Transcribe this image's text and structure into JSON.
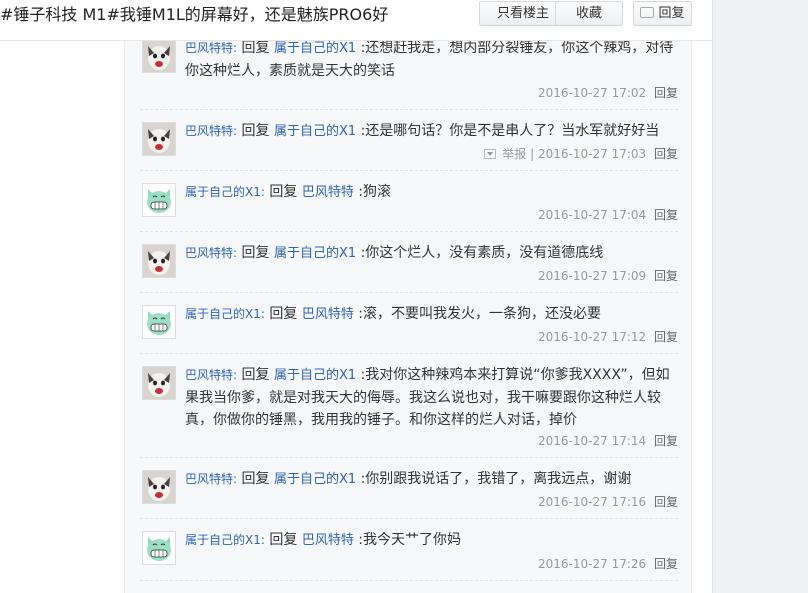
{
  "thread": {
    "title": "#锤子科技 M1#我锤M1L的屏幕好，还是魅族PRO6好",
    "buttons": {
      "only_op": "只看楼主",
      "favorite": "收藏",
      "reply": "回复"
    }
  },
  "comments": [
    {
      "user": "巴风特特:",
      "avatar": "avatar-cat-photo",
      "reply_word": "回复",
      "target": "属于自己的X1",
      "text": ":还想赶我走，想内部分裂锤友，你这个辣鸡，对待你这种烂人，素质就是天大的笑话",
      "time": "2016-10-27 17:02",
      "reply": "回复"
    },
    {
      "user": "巴风特特:",
      "avatar": "avatar-cat-photo",
      "reply_word": "回复",
      "target": "属于自己的X1",
      "text": ":还是哪句话？你是不是串人了？当水军就好好当",
      "report": "举报",
      "separator": "|",
      "time": "2016-10-27 17:03",
      "reply": "回复"
    },
    {
      "user": "属于自己的X1:",
      "avatar": "avatar-green-cat",
      "reply_word": "回复",
      "target": "巴风特特",
      "text": ":狗滚",
      "time": "2016-10-27 17:04",
      "reply": "回复"
    },
    {
      "user": "巴风特特:",
      "avatar": "avatar-cat-photo",
      "reply_word": "回复",
      "target": "属于自己的X1",
      "text": ":你这个烂人，没有素质，没有道德底线",
      "time": "2016-10-27 17:09",
      "reply": "回复"
    },
    {
      "user": "属于自己的X1:",
      "avatar": "avatar-green-cat",
      "reply_word": "回复",
      "target": "巴风特特",
      "text": ":滚，不要叫我发火，一条狗，还没必要",
      "time": "2016-10-27 17:12",
      "reply": "回复"
    },
    {
      "user": "巴风特特:",
      "avatar": "avatar-cat-photo",
      "reply_word": "回复",
      "target": "属于自己的X1",
      "text": ":我对你这种辣鸡本来打算说“你爹我XXXX”，但如果我当你爹，就是对我天大的侮辱。我这么说也对，我干嘛要跟你这种烂人较真，你做你的锤黑，我用我的锤子。和你这样的烂人对话，掉价",
      "time": "2016-10-27 17:14",
      "reply": "回复"
    },
    {
      "user": "巴风特特:",
      "avatar": "avatar-cat-photo",
      "reply_word": "回复",
      "target": "属于自己的X1",
      "text": ":你别跟我说话了，我错了，离我远点，谢谢",
      "time": "2016-10-27 17:16",
      "reply": "回复"
    },
    {
      "user": "属于自己的X1:",
      "avatar": "avatar-green-cat",
      "reply_word": "回复",
      "target": "巴风特特",
      "text": ":我今天艹了你妈",
      "time": "2016-10-27 17:26",
      "reply": "回复"
    }
  ],
  "colors": {
    "link": "#2d64b3",
    "meta": "#999999",
    "panel": "#f7f8fa"
  }
}
